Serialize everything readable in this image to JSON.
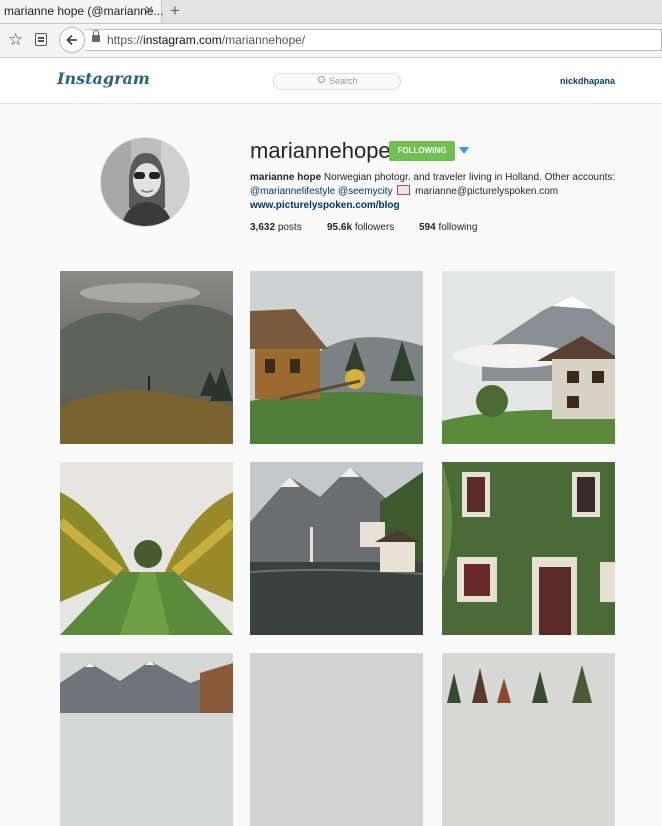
{
  "browser": {
    "tab_title": "marianne hope (@marianne...",
    "tab_close": "✕",
    "new_tab": "+",
    "url_prefix": "https://",
    "url_domain": "instagram.com",
    "url_path": "/mariannehope/"
  },
  "header": {
    "logo": "Instagram",
    "search_placeholder": "Search",
    "current_user": "nickdhapana"
  },
  "profile": {
    "username": "mariannehope",
    "follow_label": "FOLLOWING",
    "full_name": "marianne hope",
    "bio_text": " Norwegian photogr. and traveler living in Holland. Other accounts:",
    "mention_1": "@mariannelifestyle",
    "mention_2": "@seemycity",
    "email": "marianne@picturelyspoken.com",
    "website": "www.picturelyspoken.com/blog",
    "posts_count": "3,632",
    "posts_label": "posts",
    "followers_count": "95.6k",
    "followers_label": "followers",
    "following_count": "594",
    "following_label": "following"
  },
  "grid": {
    "posts": [
      "mountain-hill-hiker",
      "wooden-cabin-meadow",
      "alpine-house-fog",
      "vineyard-rows",
      "lake-village-hallstatt",
      "ivy-covered-house",
      "snowy-mountains",
      "grey-sky",
      "autumn-forest"
    ]
  },
  "colors": {
    "follow_green": "#70c050",
    "link_blue": "#003569",
    "accent_blue": "#3897f0"
  }
}
